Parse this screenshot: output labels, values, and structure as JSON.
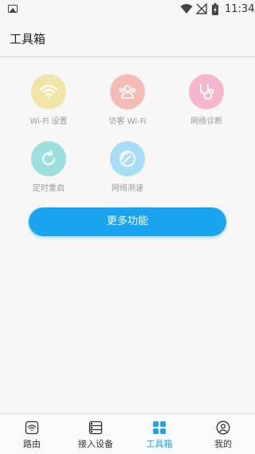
{
  "status_bar": {
    "time": "11:34",
    "icons": [
      "image-icon",
      "wifi-icon",
      "no-signal-icon",
      "battery-charging-icon"
    ]
  },
  "app_bar": {
    "title": "工具箱"
  },
  "tools": [
    {
      "label": "Wi-Fi 设置",
      "icon": "wifi-icon",
      "color": "#f4e3a6"
    },
    {
      "label": "访客 Wi-Fi",
      "icon": "guests-icon",
      "color": "#f5bcb6"
    },
    {
      "label": "网络诊断",
      "icon": "stethoscope-icon",
      "color": "#f4b5cd"
    },
    {
      "label": "定时重启",
      "icon": "refresh-icon",
      "color": "#9be0dc"
    },
    {
      "label": "网络测速",
      "icon": "speedometer-icon",
      "color": "#a9dcf7"
    }
  ],
  "more_button": {
    "label": "更多功能",
    "color": "#1aa3ef"
  },
  "bottom_nav": {
    "items": [
      {
        "label": "路由",
        "icon": "router-icon"
      },
      {
        "label": "接入设备",
        "icon": "devices-icon"
      },
      {
        "label": "工具箱",
        "icon": "toolbox-icon",
        "active": true
      },
      {
        "label": "我的",
        "icon": "profile-icon"
      }
    ],
    "active_color": "#1aa3ef"
  }
}
